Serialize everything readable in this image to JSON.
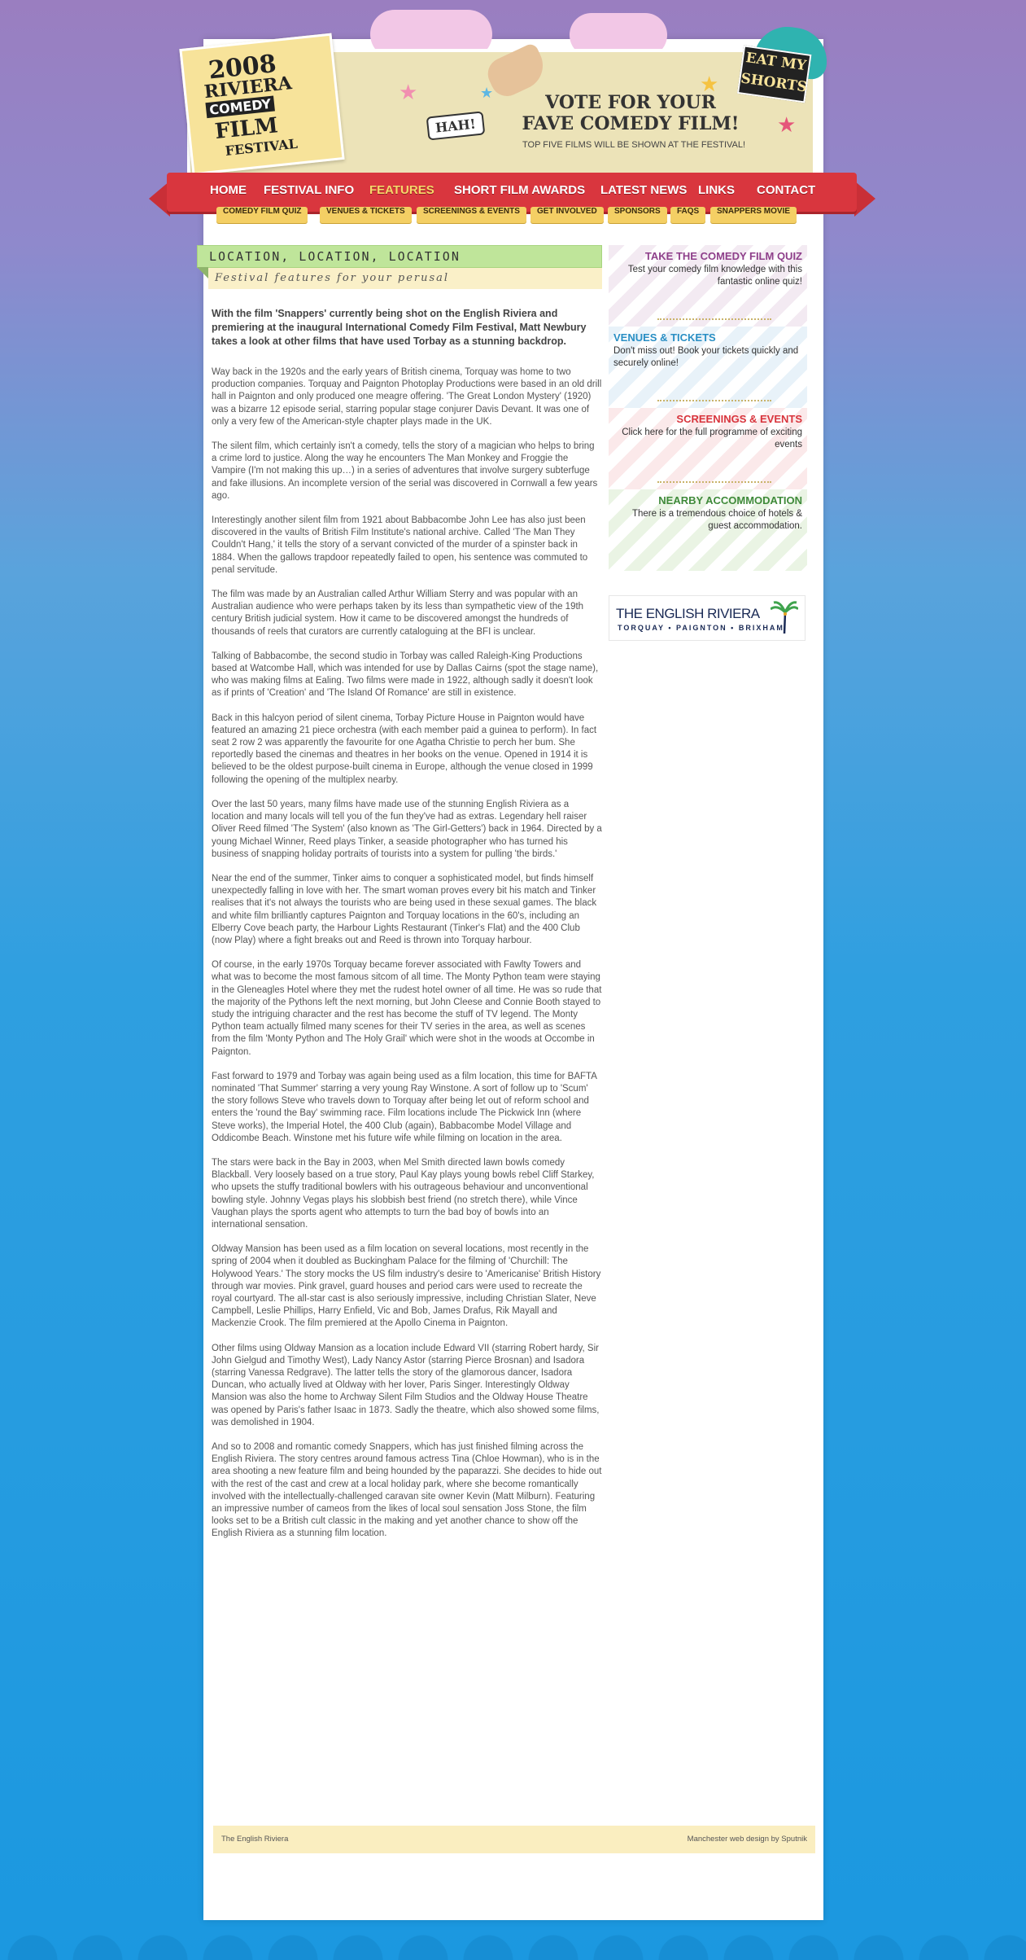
{
  "header": {
    "logo": {
      "year": "2008",
      "line1": "RIVIERA",
      "line2": "COMEDY",
      "line3": "FILM",
      "line4": "FESTIVAL"
    },
    "badge": "EAT MY SHORTS",
    "vote_line1": "VOTE FOR YOUR",
    "vote_line2": "FAVE COMEDY FILM!",
    "top_five": "TOP FIVE FILMS WILL BE SHOWN AT THE FESTIVAL!",
    "hah": "HAH!"
  },
  "nav": {
    "items": [
      "HOME",
      "FESTIVAL INFO",
      "FEATURES",
      "SHORT FILM AWARDS",
      "LATEST NEWS",
      "LINKS",
      "CONTACT"
    ],
    "active": "FEATURES"
  },
  "subnav": {
    "items": [
      "COMEDY FILM QUIZ",
      "VENUES & TICKETS",
      "SCREENINGS & EVENTS",
      "GET INVOLVED",
      "SPONSORS",
      "FAQS",
      "SNAPPERS MOVIE"
    ]
  },
  "article": {
    "title": "LOCATION, LOCATION, LOCATION",
    "subtitle": "Festival features for your perusal",
    "lead": "With the film 'Snappers' currently being shot on the English Riviera and premiering at the inaugural International Comedy Film Festival, Matt Newbury takes a look at other films that have used Torbay as a stunning backdrop.",
    "paragraphs": [
      "Way back in the 1920s and the early years of British cinema, Torquay was home to two production companies. Torquay and Paignton Photoplay Productions were based in an old drill hall in Paignton and only produced one meagre offering. 'The Great London Mystery' (1920) was a bizarre 12 episode serial, starring popular stage conjurer Davis Devant. It was one of only a very few of the American-style chapter plays made in the UK.",
      "The silent film, which certainly isn't a comedy, tells the story of a magician who helps to bring a crime lord to justice. Along the way he encounters The Man Monkey and Froggie the Vampire (I'm not making this up…) in a series of adventures that involve surgery subterfuge and fake illusions. An incomplete version of the serial was discovered in Cornwall a few years ago.",
      "Interestingly another silent film from 1921 about Babbacombe John Lee has also just been discovered in the vaults of British Film Institute's national archive. Called 'The Man They Couldn't Hang,' it tells the story of a servant convicted of the murder of a spinster back in 1884. When the gallows trapdoor repeatedly failed to open, his sentence was commuted to penal servitude.",
      "The film was made by an Australian called Arthur William Sterry and was popular with an Australian audience who were perhaps taken by its less than sympathetic view of the 19th century British judicial system. How it came to be discovered amongst the hundreds of thousands of reels that curators are currently cataloguing at the BFI is unclear.",
      "Talking of Babbacombe, the second studio in Torbay was called Raleigh-King Productions based at Watcombe Hall, which was intended for use by Dallas Cairns (spot the stage name), who was making films at Ealing. Two films were made in 1922, although sadly it doesn't look as if prints of 'Creation' and 'The Island Of Romance' are still in existence.",
      "Back in this halcyon period of silent cinema, Torbay Picture House in Paignton would have featured an amazing 21 piece orchestra (with each member paid a guinea to perform). In fact seat 2 row 2 was apparently the favourite for one Agatha Christie to perch her bum. She reportedly based the cinemas and theatres in her books on the venue. Opened in 1914 it is believed to be the oldest purpose-built cinema in Europe, although the venue closed in 1999 following the opening of the multiplex nearby.",
      "Over the last 50 years, many films have made use of the stunning English Riviera as a location and many locals will tell you of the fun they've had as extras. Legendary hell raiser Oliver Reed filmed 'The System' (also known as 'The Girl-Getters') back in 1964. Directed by a young Michael Winner, Reed plays Tinker, a seaside photographer who has turned his business of snapping holiday portraits of tourists into a system for pulling 'the birds.'",
      "Near the end of the summer, Tinker aims to conquer a sophisticated model, but finds himself unexpectedly falling in love with her. The smart woman proves every bit his match and Tinker realises that it's not always the tourists who are being used in these sexual games. The black and white film brilliantly captures Paignton and Torquay locations in the 60's, including an Elberry Cove beach party, the Harbour Lights Restaurant (Tinker's Flat) and the 400 Club (now Play) where a fight breaks out and Reed is thrown into Torquay harbour.",
      "Of course, in the early 1970s Torquay became forever associated with Fawlty Towers and what was to become the most famous sitcom of all time. The Monty Python team were staying in the Gleneagles Hotel where they met the rudest hotel owner of all time. He was so rude that the majority of the Pythons left the next morning, but John Cleese and Connie Booth stayed to study the intriguing character and the rest has become the stuff of TV legend. The Monty Python team actually filmed many scenes for their TV series in the area, as well as scenes from the film 'Monty Python and The Holy Grail' which were shot in the woods at Occombe in Paignton.",
      "Fast forward to 1979 and Torbay was again being used as a film location, this time for BAFTA nominated 'That Summer' starring a very young Ray Winstone. A sort of follow up to 'Scum' the story follows Steve who travels down to Torquay after being let out of reform school and enters the 'round the Bay' swimming race. Film locations include The Pickwick Inn (where Steve works), the Imperial Hotel, the 400 Club (again), Babbacombe Model Village and Oddicombe Beach. Winstone met his future wife while filming on location in the area.",
      "The stars were back in the Bay in 2003, when Mel Smith directed lawn bowls comedy Blackball. Very loosely based on a true story, Paul Kay plays young bowls rebel Cliff Starkey, who upsets the stuffy traditional bowlers with his outrageous behaviour and unconventional bowling style. Johnny Vegas plays his slobbish best friend (no stretch there), while Vince Vaughan plays the sports agent who attempts to turn the bad boy of bowls into an international sensation.",
      "Oldway Mansion has been used as a film location on several locations, most recently in the spring of 2004 when it doubled as Buckingham Palace for the filming of 'Churchill: The Holywood Years.' The story mocks the US film industry's desire to 'Americanise' British History through war movies. Pink gravel, guard houses and period cars were used to recreate the royal courtyard. The all-star cast is also seriously impressive, including Christian Slater, Neve Campbell, Leslie Phillips, Harry Enfield, Vic and Bob, James Drafus, Rik Mayall and Mackenzie Crook. The film premiered at the Apollo Cinema in Paignton.",
      "Other films using Oldway Mansion as a location include Edward VII (starring Robert hardy, Sir John Gielgud and Timothy West), Lady Nancy Astor (starring Pierce Brosnan) and Isadora (starring Vanessa Redgrave). The latter tells the story of the glamorous dancer, Isadora Duncan, who actually lived at Oldway with her lover, Paris Singer. Interestingly Oldway Mansion was also the home to Archway Silent Film Studios and the Oldway House Theatre was opened by Paris's father Isaac in 1873. Sadly the theatre, which also showed some films, was demolished in 1904.",
      "And so to 2008 and romantic comedy Snappers, which has just finished filming across the English Riviera. The story centres around famous actress Tina (Chloe Howman), who is in the area shooting a new feature film and being hounded by the paparazzi. She decides to hide out with the rest of the cast and crew at a local holiday park, where she become romantically involved with the intellectually-challenged caravan site owner Kevin (Matt Milburn). Featuring an impressive number of cameos from the likes of local soul sensation Joss Stone, the film looks set to be a British cult classic in the making and yet another chance to show off the English Riviera as a stunning film location."
    ]
  },
  "sidebar": {
    "promos": [
      {
        "title": "TAKE THE COMEDY FILM QUIZ",
        "text": "Test your comedy film knowledge with this fantastic online quiz!",
        "color": "#8e3f8a",
        "bg": "#f3eaf2"
      },
      {
        "title": "VENUES & TICKETS",
        "text": "Don't miss out! Book your tickets quickly and securely online!",
        "color": "#2a8fc4",
        "bg": "#e8f2f9"
      },
      {
        "title": "SCREENINGS & EVENTS",
        "text": "Click here for the full programme of exciting events",
        "color": "#d8343c",
        "bg": "#fbe9ea"
      },
      {
        "title": "NEARBY ACCOMMODATION",
        "text": "There is a tremendous choice of hotels & guest accommodation.",
        "color": "#3f8a3a",
        "bg": "#eaf4e4"
      }
    ],
    "riviera_logo": {
      "line1": "THE ENGLISH RIVIERA",
      "line2": "TORQUAY • PAIGNTON • BRIXHAM"
    }
  },
  "footer": {
    "left": "The English Riviera",
    "right": "Manchester web design by Sputnik"
  }
}
